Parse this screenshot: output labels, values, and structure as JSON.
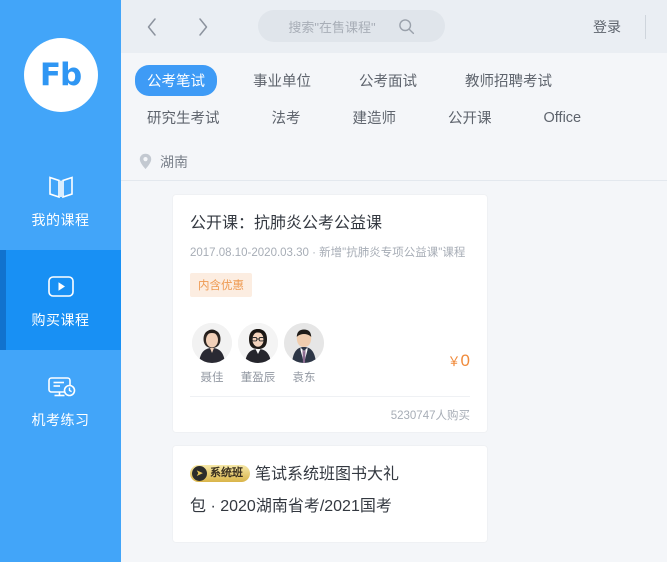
{
  "sidebar": {
    "logo_text": "Fb",
    "items": [
      {
        "label": "我的课程",
        "icon": "book-icon",
        "active": false
      },
      {
        "label": "购买课程",
        "icon": "play-video-icon",
        "active": true
      },
      {
        "label": "机考练习",
        "icon": "computer-clock-icon",
        "active": false
      }
    ]
  },
  "topbar": {
    "back_icon": "chevron-left-icon",
    "forward_icon": "chevron-right-icon",
    "search_placeholder": "搜索\"在售课程\"",
    "search_icon": "search-icon",
    "login_label": "登录"
  },
  "tabs": {
    "row1": [
      {
        "label": "公考笔试",
        "active": true
      },
      {
        "label": "事业单位",
        "active": false
      },
      {
        "label": "公考面试",
        "active": false
      },
      {
        "label": "教师招聘考试",
        "active": false
      }
    ],
    "row2": [
      {
        "label": "研究生考试",
        "active": false
      },
      {
        "label": "法考",
        "active": false
      },
      {
        "label": "建造师",
        "active": false
      },
      {
        "label": "公开课",
        "active": false
      },
      {
        "label": "Office",
        "active": false
      }
    ]
  },
  "location": {
    "icon": "location-pin-icon",
    "label": "湖南"
  },
  "cards": [
    {
      "title": "公开课：抗肺炎公考公益课",
      "subtitle": "2017.08.10-2020.03.30 · 新增\"抗肺炎专项公益课\"课程",
      "badge": "内含优惠",
      "teachers": [
        {
          "name": "聂佳"
        },
        {
          "name": "董盈辰"
        },
        {
          "name": "袁东"
        }
      ],
      "price": "0",
      "currency": "￥",
      "purchases": "5230747人购买"
    },
    {
      "sys_badge": "系统班",
      "sys_badge_icon": "rocket-icon",
      "title": "笔试系统班图书大礼",
      "subtitle": "包 · 2020湖南省考/2021国考"
    }
  ],
  "colors": {
    "sidebar_bg": "#42A5F9",
    "sidebar_active_bg": "#1890F4",
    "sidebar_active_edge": "#1172CE",
    "accent_blue": "#3E9BF6",
    "price_orange": "#F08B3C",
    "badge_bg": "#FCEDE1",
    "badge_text": "#EE9A52",
    "page_bg": "#F4F6F9",
    "topbar_bg": "#EAEEF3"
  }
}
